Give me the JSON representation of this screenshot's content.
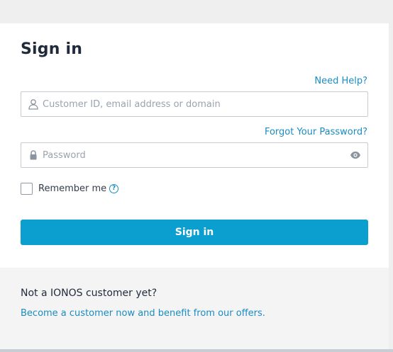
{
  "login": {
    "title": "Sign in",
    "need_help": "Need Help?",
    "username_placeholder": "Customer ID, email address or domain",
    "username_value": "",
    "forgot_password": "Forgot Your Password?",
    "password_placeholder": "Password",
    "password_value": "",
    "remember_me": "Remember me",
    "remember_checked": false,
    "help_glyph": "?",
    "submit_label": "Sign in"
  },
  "footer": {
    "title": "Not a IONOS customer yet?",
    "link": "Become a customer now and benefit from our offers."
  },
  "icons": {
    "user": "user-icon",
    "lock": "lock-icon",
    "eye": "eye-icon",
    "help": "question-circle-icon"
  },
  "colors": {
    "accent": "#0b9fcf",
    "link": "#1a8cc0",
    "text": "#1f2a3a"
  }
}
